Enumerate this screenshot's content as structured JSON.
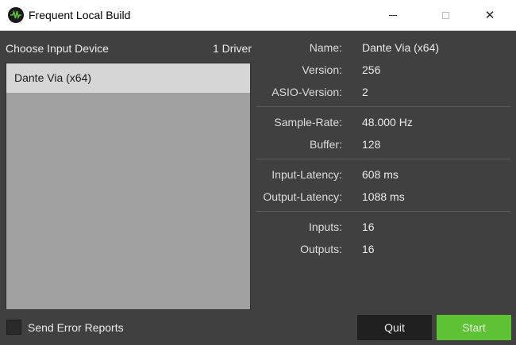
{
  "window": {
    "title": "Frequent Local Build",
    "icon": "waveform-icon",
    "minimize_glyph": "minimize-icon",
    "maximize_glyph": "maximize-icon",
    "close_glyph": "✕"
  },
  "device_panel": {
    "heading": "Choose Input Device",
    "driver_count": "1 Driver",
    "devices": [
      "Dante Via (x64)"
    ],
    "selected_index": 0
  },
  "info": {
    "name_label": "Name:",
    "name_value": "Dante Via (x64)",
    "version_label": "Version:",
    "version_value": "256",
    "asio_version_label": "ASIO-Version:",
    "asio_version_value": "2",
    "sample_rate_label": "Sample-Rate:",
    "sample_rate_value": "48.000 Hz",
    "buffer_label": "Buffer:",
    "buffer_value": "128",
    "input_latency_label": "Input-Latency:",
    "input_latency_value": "608 ms",
    "output_latency_label": "Output-Latency:",
    "output_latency_value": "1088 ms",
    "inputs_label": "Inputs:",
    "inputs_value": "16",
    "outputs_label": "Outputs:",
    "outputs_value": "16"
  },
  "footer": {
    "error_reports_label": "Send Error Reports",
    "error_reports_checked": false,
    "quit_label": "Quit",
    "start_label": "Start"
  },
  "colors": {
    "background": "#404040",
    "start_button": "#5dc234",
    "quit_button": "#202020",
    "selected_item": "#d6d6d6",
    "list_background": "#a0a0a0"
  }
}
